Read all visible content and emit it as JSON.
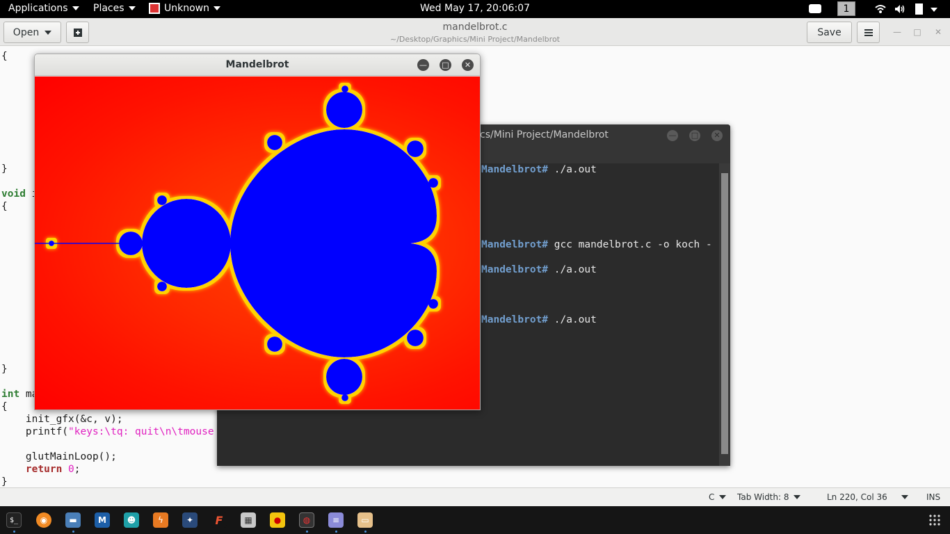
{
  "topbar": {
    "applications": "Applications",
    "places": "Places",
    "app_menu": "Unknown",
    "clock": "Wed May 17, 20:06:07",
    "workspace": "1"
  },
  "gedit": {
    "open_label": "Open",
    "save_label": "Save",
    "doc_title": "mandelbrot.c",
    "doc_path": "~/Desktop/Graphics/Mini Project/Mandelbrot",
    "status": {
      "language": "C",
      "tab_width": "Tab Width: 8",
      "position": "Ln 220, Col 36",
      "mode": "INS"
    }
  },
  "code": {
    "line_brace1": "{",
    "line_close1": "}",
    "line_void_kw": "void",
    "line_void_rest": " i",
    "line_brace2": "{",
    "line_close2": "}",
    "line_int_kw": "int",
    "line_int_rest": " ma",
    "line_brace3": "{",
    "line_init": "    init_gfx(&c, v);",
    "line_printf_a": "    printf(",
    "line_printf_str": "\"keys:\\tq: quit\\n\\tmouse buttons to zoom\\n\"",
    "line_printf_b": ");",
    "line_loop": "    glutMainLoop();",
    "line_return_kw": "return",
    "line_return_num": "0",
    "line_return_end": ";",
    "line_close3": "}"
  },
  "terminal": {
    "title": "cs/Mini Project/Mandelbrot",
    "lines": [
      {
        "prompt": "Mandelbrot#",
        "cmd": " ./a.out"
      },
      {
        "prompt": "Mandelbrot#",
        "cmd": " gcc mandelbrot.c -o koch -"
      },
      {
        "prompt": "Mandelbrot#",
        "cmd": " ./a.out"
      },
      {
        "prompt": "Mandelbrot#",
        "cmd": " ./a.out"
      }
    ]
  },
  "mandelbrot": {
    "title": "Mandelbrot",
    "colors": {
      "background": "#ff0000",
      "set": "#0000ff",
      "edge": "#ffd200"
    }
  },
  "dock": {
    "icons": [
      "terminal-icon",
      "firefox-icon",
      "files-icon",
      "metasploit-icon",
      "armitage-icon",
      "burpsuite-icon",
      "maltego-icon",
      "faraday-icon",
      "leafpad-icon",
      "cherrytree-icon",
      "screenshot-icon",
      "notes-icon",
      "archive-icon"
    ]
  }
}
